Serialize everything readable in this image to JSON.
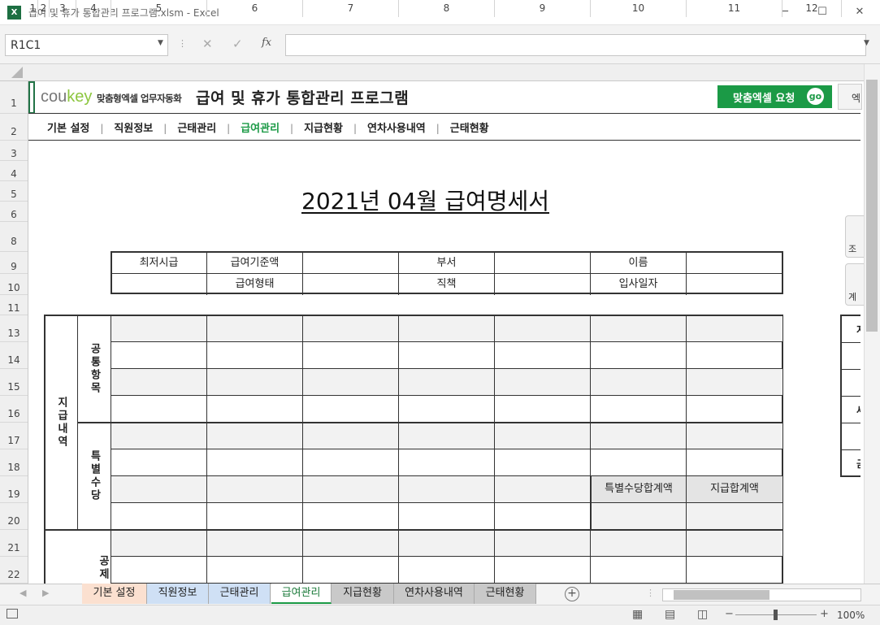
{
  "window": {
    "title": "급여 및 휴가 통합관리 프로그램.xlsm - Excel",
    "minimize": "─",
    "maximize": "☐",
    "close": "✕",
    "app_icon": "X"
  },
  "formula_bar": {
    "name_box": "R1C1",
    "cancel": "✕",
    "enter": "✓",
    "fx": "fx",
    "value": ""
  },
  "columns": [
    "1",
    "2",
    "3",
    "4",
    "5",
    "6",
    "7",
    "8",
    "9",
    "10",
    "11",
    "12"
  ],
  "rows": [
    "1",
    "2",
    "3",
    "4",
    "5",
    "6",
    "8",
    "9",
    "10",
    "11",
    "13",
    "14",
    "15",
    "16",
    "17",
    "18",
    "19",
    "20",
    "21",
    "22"
  ],
  "header": {
    "logo_main": "cou",
    "logo_key": "key",
    "logo_sub": "맞춤형엑셀 업무자동화",
    "title": "급여 및 휴가 통합관리 프로그램",
    "request_button": "맞춤엑셀 요청",
    "go": "go",
    "side_button": "엑"
  },
  "nav": [
    "기본 설정",
    "직원정보",
    "근태관리",
    "급여관리",
    "지급현황",
    "연차사용내역",
    "근태현황"
  ],
  "nav_active": "급여관리",
  "document": {
    "title": "2021년 04월 급여명세서"
  },
  "info_table": {
    "r1": [
      "최저시급",
      "급여기준액",
      "",
      "부서",
      "",
      "이름",
      ""
    ],
    "r2": [
      "",
      "급여형태",
      "",
      "직책",
      "",
      "입사일자",
      ""
    ]
  },
  "pay_table": {
    "section_pay": "지급내역",
    "group_common": "공통항목",
    "group_special": "특별수당",
    "special_total": "특별수당합계액",
    "pay_total": "지급합계액",
    "section_deduct": "공제"
  },
  "side_buttons": {
    "lookup": "조회",
    "calc": "계산"
  },
  "right_float": [
    "지",
    "",
    "",
    "세",
    "",
    "금"
  ],
  "sheet_tabs": [
    {
      "label": "기본 설정",
      "color": "#fbe0d0"
    },
    {
      "label": "직원정보",
      "color": "#cfe0f5"
    },
    {
      "label": "근태관리",
      "color": "#cfe0f5"
    },
    {
      "label": "급여관리",
      "color": "#ffffff"
    },
    {
      "label": "지급현황",
      "color": "#c9c9c9"
    },
    {
      "label": "연차사용내역",
      "color": "#c9c9c9"
    },
    {
      "label": "근태현황",
      "color": "#c9c9c9"
    }
  ],
  "status": {
    "zoom": "100%"
  }
}
